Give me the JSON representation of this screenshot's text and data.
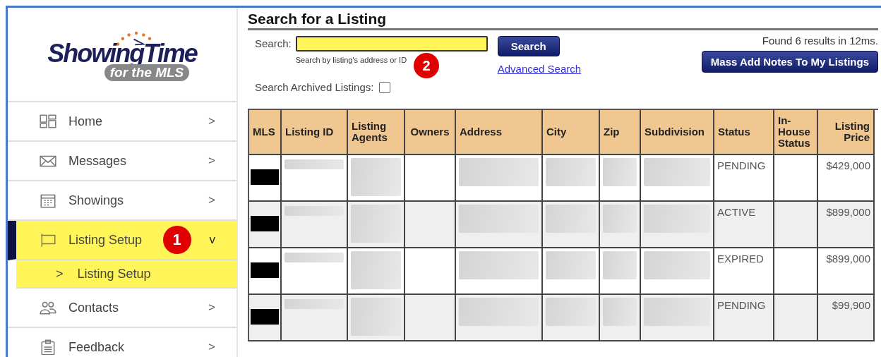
{
  "logo": {
    "name": "ShowingTime",
    "tagline": "for the MLS"
  },
  "nav": [
    {
      "label": "Home",
      "chevron": ">",
      "selected": false,
      "expanded": false
    },
    {
      "label": "Messages",
      "chevron": ">",
      "selected": false,
      "expanded": false
    },
    {
      "label": "Showings",
      "chevron": ">",
      "selected": false,
      "expanded": false
    },
    {
      "label": "Listing Setup",
      "chevron": "v",
      "selected": true,
      "expanded": true,
      "callout": "1",
      "children": [
        {
          "label": "Listing Setup",
          "chevron": ">",
          "selected": true
        }
      ]
    },
    {
      "label": "Contacts",
      "chevron": ">",
      "selected": false,
      "expanded": false
    },
    {
      "label": "Feedback",
      "chevron": ">",
      "selected": false,
      "expanded": false
    }
  ],
  "page_title": "Search for a Listing",
  "search": {
    "label": "Search:",
    "hint": "Search by listing's address or ID",
    "callout": "2",
    "button": "Search",
    "advanced_link": "Advanced Search"
  },
  "archived": {
    "label": "Search Archived Listings:",
    "checked": false
  },
  "results_summary": "Found 6 results in 12ms.",
  "mass_add_button": "Mass Add Notes To My Listings",
  "table": {
    "columns": [
      "MLS",
      "Listing ID",
      "Listing Agents",
      "Owners",
      "Address",
      "City",
      "Zip",
      "Subdivision",
      "Status",
      "In-House Status",
      "Listing Price"
    ],
    "rows": [
      {
        "status": "PENDING",
        "listing_price": "$429,000"
      },
      {
        "status": "ACTIVE",
        "listing_price": "$899,000"
      },
      {
        "status": "EXPIRED",
        "listing_price": "$899,000"
      },
      {
        "status": "PENDING",
        "listing_price": "$99,900"
      }
    ]
  }
}
